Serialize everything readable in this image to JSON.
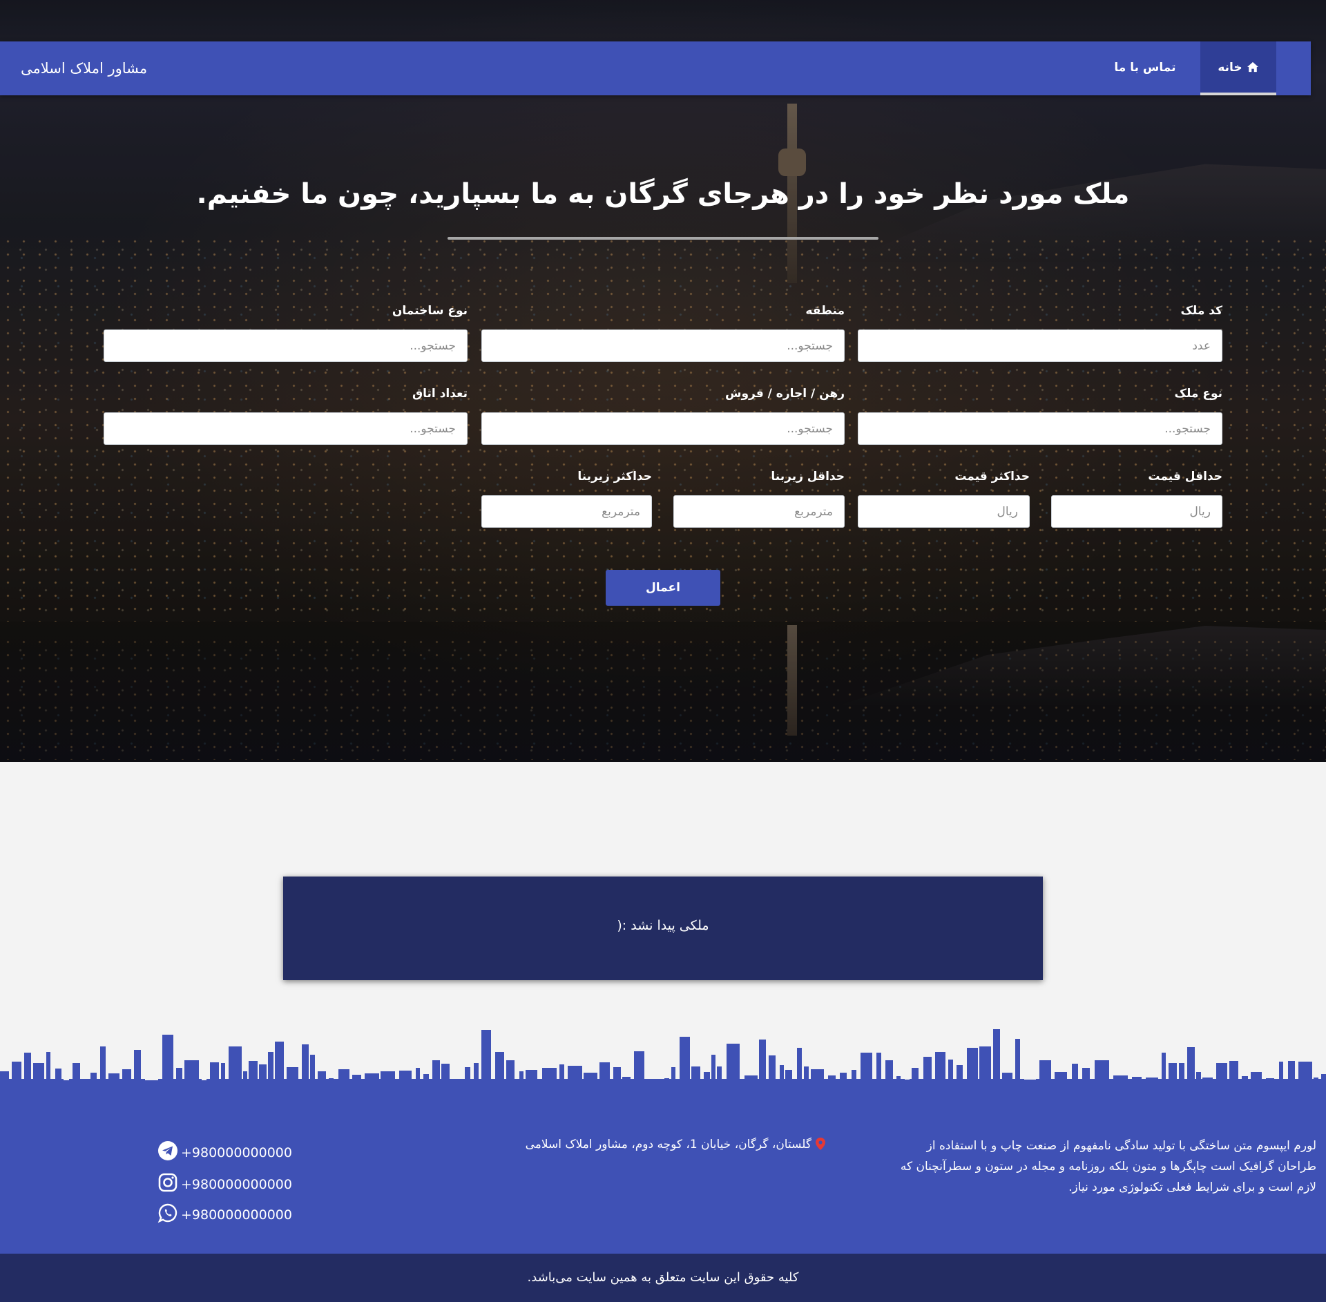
{
  "nav": {
    "brand": "مشاور املاک اسلامی",
    "home_label": "خانه",
    "contact_label": "تماس با ما"
  },
  "hero": {
    "headline": "ملک مورد نظر خود را در هرجای گرگان به ما بسپارید، چون ما خفنیم."
  },
  "search_form": {
    "fields": [
      {
        "label": "کد ملک",
        "placeholder": "عدد"
      },
      {
        "label": "منطقه",
        "placeholder": "جستجو..."
      },
      {
        "label": "نوع ساختمان",
        "placeholder": "جستجو..."
      },
      {
        "label": "نوع ملک",
        "placeholder": "جستجو..."
      },
      {
        "label": "رهن / اجاره / فروش",
        "placeholder": "جستجو..."
      },
      {
        "label": "تعداد اتاق",
        "placeholder": "جستجو..."
      },
      {
        "label": "حداقل قیمت",
        "placeholder": "ریال"
      },
      {
        "label": "حداکثر قیمت",
        "placeholder": "ریال"
      },
      {
        "label": "حداقل زیربنا",
        "placeholder": "مترمربع"
      },
      {
        "label": "حداکثر زیربنا",
        "placeholder": "مترمربع"
      }
    ],
    "submit_label": "اعمال"
  },
  "results": {
    "empty_message": "ملکی پیدا نشد :("
  },
  "footer": {
    "about": "لورم ایپسوم متن ساختگی با تولید سادگی نامفهوم از صنعت چاپ و با استفاده از طراحان گرافیک است چاپگرها و متون بلکه روزنامه و مجله در ستون و سطرآنچنان که لازم است و برای شرایط فعلی تکنولوژی مورد نیاز.",
    "address": "گلستان، گرگان، خیابان 1، کوچه دوم، مشاور املاک اسلامی",
    "contacts": [
      {
        "icon": "telegram-icon",
        "value": "+980000000000"
      },
      {
        "icon": "instagram-icon",
        "value": "+980000000000"
      },
      {
        "icon": "whatsapp-icon",
        "value": "+980000000000"
      }
    ],
    "copyright": "کلیه حقوق این سایت متعلق به همین سایت می‌باشد."
  },
  "colors": {
    "primary": "#3f51b5",
    "primary_dark": "#232c62",
    "page_bg": "#f3f3f3",
    "pin": "#e53935"
  }
}
